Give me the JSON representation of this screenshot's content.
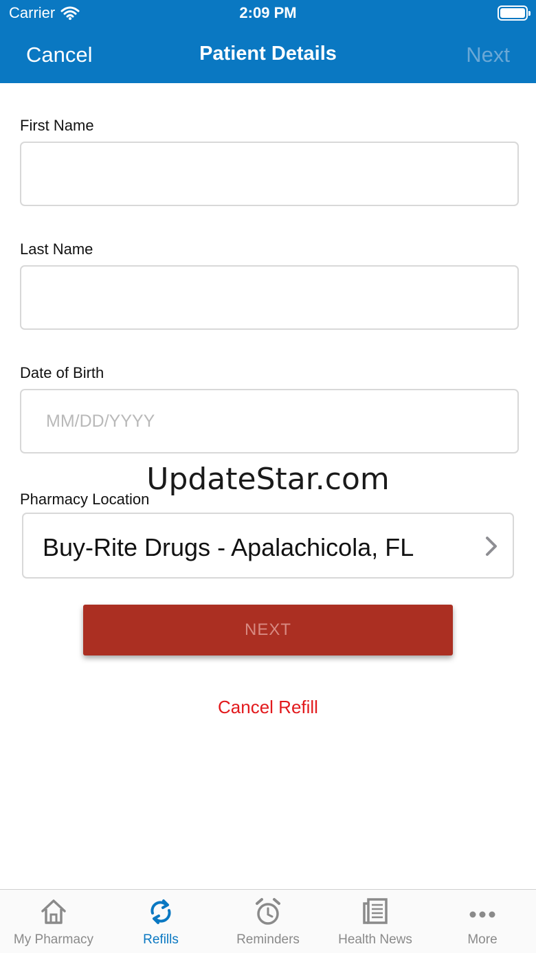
{
  "status_bar": {
    "carrier": "Carrier",
    "time": "2:09 PM"
  },
  "nav": {
    "cancel_label": "Cancel",
    "title": "Patient Details",
    "next_label": "Next"
  },
  "form": {
    "first_name": {
      "label": "First Name",
      "value": ""
    },
    "last_name": {
      "label": "Last Name",
      "value": ""
    },
    "dob": {
      "label": "Date of Birth",
      "placeholder": "MM/DD/YYYY",
      "value": ""
    },
    "pharmacy": {
      "label": "Pharmacy Location",
      "value": "Buy-Rite Drugs - Apalachicola, FL"
    }
  },
  "watermark": "UpdateStar.com",
  "buttons": {
    "next": "NEXT",
    "cancel_refill": "Cancel Refill"
  },
  "tabs": [
    {
      "label": "My Pharmacy",
      "icon": "home-icon",
      "active": false
    },
    {
      "label": "Refills",
      "icon": "refresh-icon",
      "active": true
    },
    {
      "label": "Reminders",
      "icon": "alarm-clock-icon",
      "active": false
    },
    {
      "label": "Health News",
      "icon": "newspaper-icon",
      "active": false
    },
    {
      "label": "More",
      "icon": "more-dots-icon",
      "active": false
    }
  ],
  "colors": {
    "nav_blue": "#0a78c2",
    "button_red": "#ab2f22",
    "cancel_red": "#e2191c",
    "tab_gray": "#8a8a8a"
  }
}
